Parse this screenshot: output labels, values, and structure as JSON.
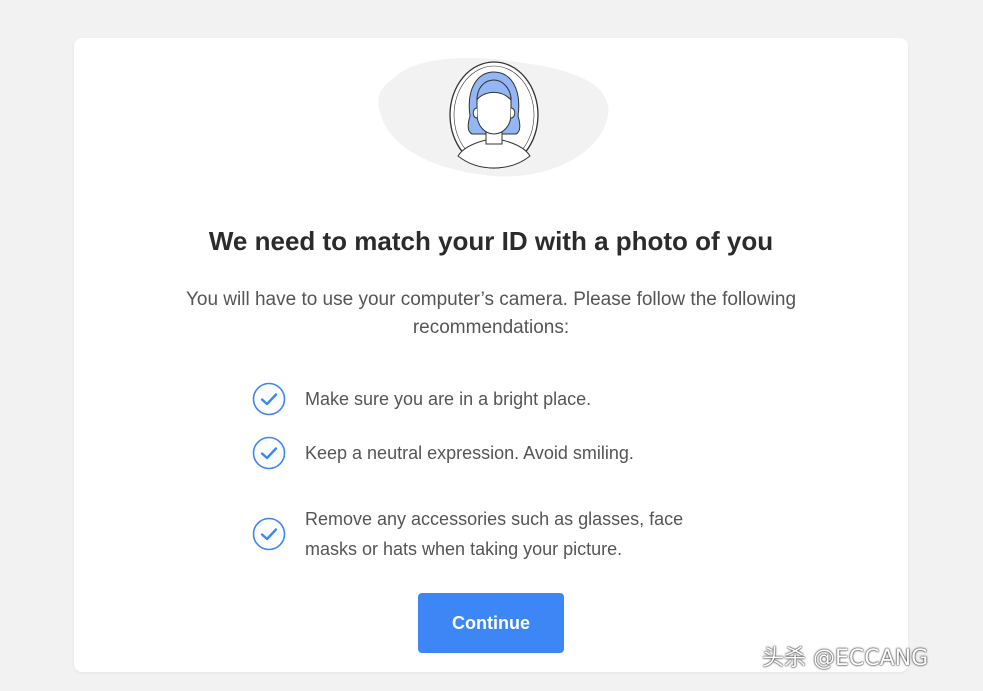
{
  "colors": {
    "page_background": "#f2f2f2",
    "card_background": "#ffffff",
    "accent": "#3d86f5",
    "heading_text": "#2b2b2b",
    "body_text": "#555555",
    "check_icon": "#3d86f5",
    "illustration_hair": "#93b6f4",
    "illustration_blob": "#f2f2f2"
  },
  "illustration": {
    "icon": "face-photo-illustration"
  },
  "heading": {
    "title": "We need to match your ID with a photo of you",
    "subtitle": "You will have to use your computer’s camera. Please follow the following recommendations:"
  },
  "recommendations": [
    {
      "icon": "check-circle-icon",
      "text": "Make sure you are in a bright place."
    },
    {
      "icon": "check-circle-icon",
      "text": "Keep a neutral expression. Avoid smiling."
    },
    {
      "icon": "check-circle-icon",
      "text": "Remove any accessories such as glasses, face masks or hats when taking your picture."
    }
  ],
  "actions": {
    "continue_label": "Continue"
  },
  "watermark": {
    "text": "头杀 @ECCANG"
  }
}
